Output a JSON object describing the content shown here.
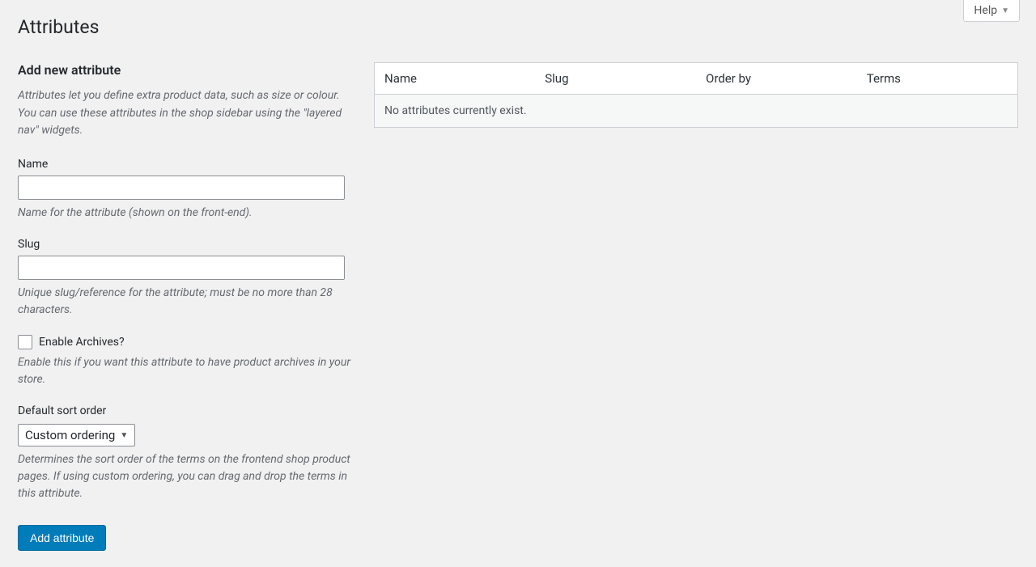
{
  "help": {
    "label": "Help"
  },
  "page": {
    "title": "Attributes"
  },
  "form": {
    "heading": "Add new attribute",
    "intro": "Attributes let you define extra product data, such as size or colour. You can use these attributes in the shop sidebar using the \"layered nav\" widgets.",
    "name": {
      "label": "Name",
      "value": "",
      "help": "Name for the attribute (shown on the front-end)."
    },
    "slug": {
      "label": "Slug",
      "value": "",
      "help": "Unique slug/reference for the attribute; must be no more than 28 characters."
    },
    "enable_archives": {
      "label": "Enable Archives?",
      "help": "Enable this if you want this attribute to have product archives in your store."
    },
    "sort_order": {
      "label": "Default sort order",
      "selected": "Custom ordering",
      "help": "Determines the sort order of the terms on the frontend shop product pages. If using custom ordering, you can drag and drop the terms in this attribute."
    },
    "submit_label": "Add attribute"
  },
  "table": {
    "columns": {
      "name": "Name",
      "slug": "Slug",
      "order_by": "Order by",
      "terms": "Terms"
    },
    "empty_message": "No attributes currently exist."
  }
}
